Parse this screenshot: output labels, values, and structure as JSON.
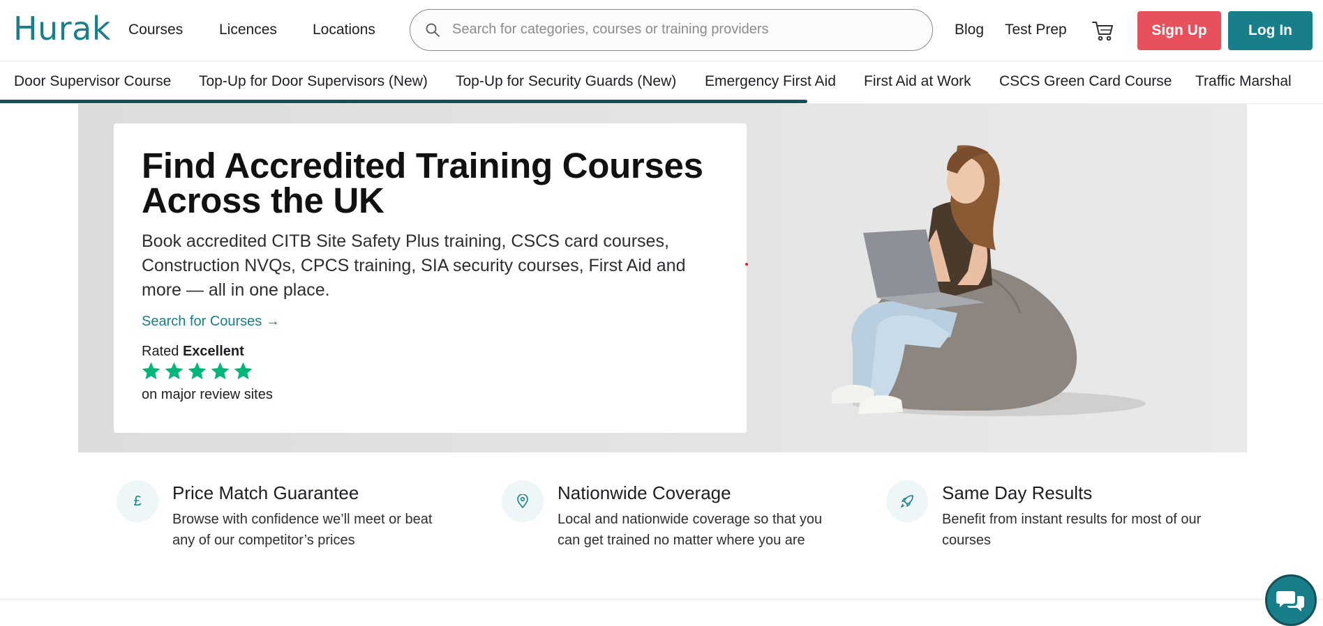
{
  "header": {
    "logo": "Hurak",
    "nav": [
      "Courses",
      "Licences",
      "Locations"
    ],
    "search_placeholder": "Search for categories, courses or training providers",
    "links": [
      "Blog",
      "Test Prep"
    ],
    "signup_label": "Sign Up",
    "login_label": "Log In"
  },
  "categories": {
    "items": [
      "Door Supervisor Course",
      "Top-Up for Door Supervisors (New)",
      "Top-Up for Security Guards (New)",
      "Emergency First Aid",
      "First Aid at Work",
      "CSCS Green Card Course",
      "Traffic Marshal"
    ],
    "scroll_progress": 0.61
  },
  "hero": {
    "title": "Find Accredited Training Courses Across the UK",
    "description": "Book accredited CITB Site Safety Plus training, CSCS card courses, Construction NVQs, CPCS training, SIA security courses, First Aid and more — all in one place.",
    "cta": "Search for Courses →",
    "rated_prefix": "Rated",
    "rated_value": "Excellent",
    "stars": 5,
    "review_text": "on major review sites"
  },
  "features": [
    {
      "icon": "pound-icon",
      "symbol": "£",
      "title": "Price Match Guarantee",
      "text": "Browse with confidence we’ll meet or beat any of our competitor’s prices"
    },
    {
      "icon": "location-pin-icon",
      "symbol": "",
      "title": "Nationwide Coverage",
      "text": "Local and nationwide coverage so that you can get trained no matter where you are"
    },
    {
      "icon": "rocket-icon",
      "symbol": "",
      "title": "Same Day Results",
      "text": "Benefit from instant results for most of our courses"
    }
  ],
  "colors": {
    "brand": "#187e8a",
    "signup": "#e8505b",
    "star": "#00b67a"
  }
}
